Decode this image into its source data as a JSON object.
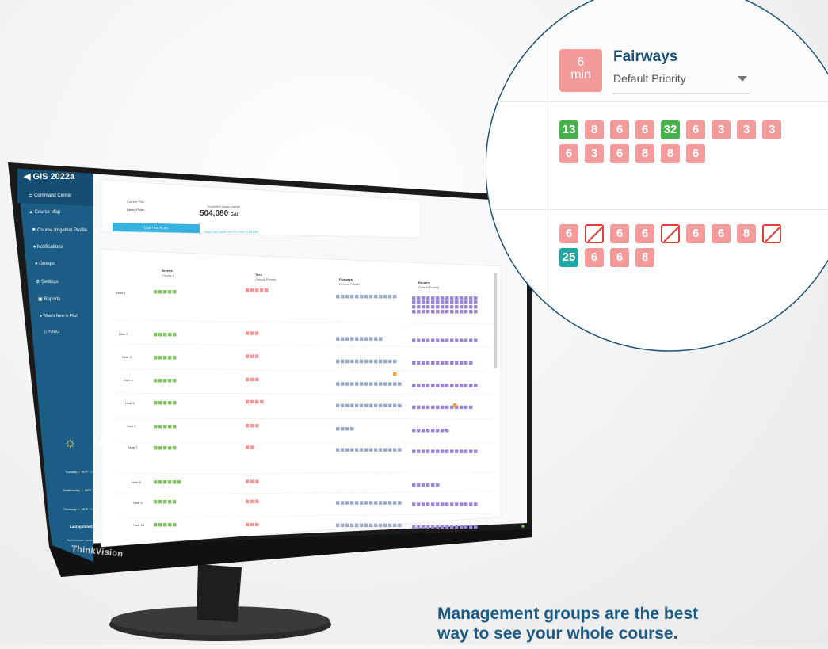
{
  "app": {
    "title": "GIS 2022a",
    "brand": "ThinkVision"
  },
  "sidebar": {
    "items": [
      {
        "label": "Command Center",
        "icon": "command-center-icon"
      },
      {
        "label": "Course Map",
        "icon": "map-icon"
      },
      {
        "label": "Course Irrigation Profile",
        "icon": "flag-icon"
      },
      {
        "label": "Notifications",
        "icon": "bell-icon"
      },
      {
        "label": "Groups",
        "icon": "groups-icon"
      },
      {
        "label": "Settings",
        "icon": "gear-icon"
      },
      {
        "label": "Reports",
        "icon": "reports-icon"
      },
      {
        "label": "What's New In Pilot",
        "icon": "info-icon"
      },
      {
        "label": "POGO",
        "icon": "pogo-icon"
      }
    ],
    "weather": {
      "temp": "86°F",
      "forecast": [
        {
          "day": "Tuesday",
          "hi": "90°F",
          "lo": "72°F"
        },
        {
          "day": "Wednesday",
          "hi": "88°F",
          "lo": "70°F"
        },
        {
          "day": "Thursday",
          "hi": "90°F",
          "lo": "72°F"
        }
      ],
      "last_updated": "Last updated: 11:31 AM",
      "status": "Field interface connected"
    }
  },
  "header": {
    "current_plan_label": "Current Plan",
    "current_plan_value": "Default Plan",
    "expected_usage_label": "Expected Water Usage",
    "expected_usage_value": "504,080",
    "expected_usage_unit": "GAL",
    "use_plan_button": "USE THIS PLAN",
    "plan_note": "Plan Last Used: Jan 25 2022 5:24 AM"
  },
  "groups": [
    {
      "name": "Greens",
      "priority": "Priority 1",
      "color": "#7bbf6a"
    },
    {
      "name": "Tees",
      "priority": "Default Priority",
      "color": "#f39a9a"
    },
    {
      "name": "Fairways",
      "priority": "Default Priority",
      "color": "#9aa8c7"
    },
    {
      "name": "Roughs",
      "priority": "Default Priority",
      "color": "#9a8ad6"
    }
  ],
  "holes": [
    "Hole 1",
    "Hole 2",
    "Hole 3",
    "Hole 4",
    "Hole 5",
    "Hole 6",
    "Hole 7",
    "Hole 8",
    "Hole 9",
    "Hole 10"
  ],
  "magnifier": {
    "time_value": "6",
    "time_unit": "min",
    "group_name": "Fairways",
    "priority_select": "Default Priority",
    "row1": [
      "13",
      "8",
      "6",
      "6",
      "32",
      "6",
      "3",
      "3",
      "3",
      "6",
      "3",
      "6",
      "8",
      "8",
      "6"
    ],
    "row2": [
      "6",
      "",
      "6",
      "6",
      "",
      "6",
      "6",
      "8",
      "",
      "25",
      "6",
      "6",
      "8"
    ]
  },
  "caption": {
    "line1": "Management groups are the best",
    "line2": "way to see your whole course."
  },
  "colors": {
    "sidebar": "#1b5d85",
    "accent": "#36b3e0",
    "caption": "#1c5b86"
  }
}
